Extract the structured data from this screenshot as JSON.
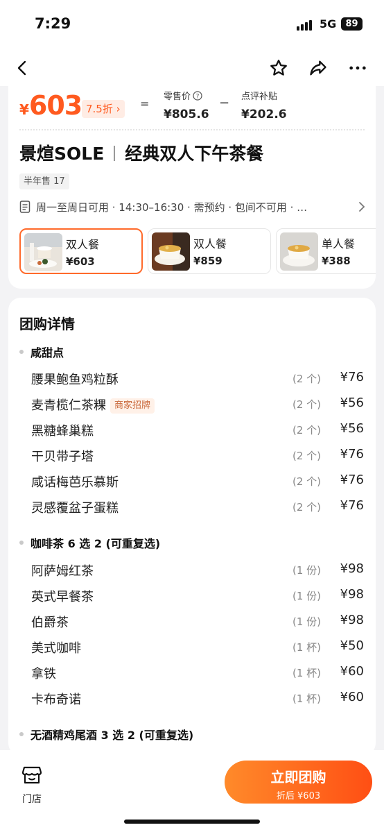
{
  "status_bar": {
    "time": "7:29",
    "network": "5G",
    "battery": "89"
  },
  "nav": {
    "icons": [
      "back-icon",
      "star-icon",
      "share-icon",
      "more-icon"
    ]
  },
  "price": {
    "symbol": "¥",
    "amount": "603",
    "discount": "7.5折",
    "equals": "=",
    "retail_label": "零售价",
    "retail_value": "¥805.6",
    "minus": "−",
    "subsidy_label": "点评补贴",
    "subsidy_value": "¥202.6"
  },
  "deal": {
    "brand": "景煊SOLE",
    "name": "经典双人下午茶餐",
    "sales": "半年售 17",
    "usage": "周一至周日可用 · 14:30–16:30 · 需预约 · 包间不可用 · …"
  },
  "packages": [
    {
      "name": "双人餐",
      "price": "¥603",
      "selected": true
    },
    {
      "name": "双人餐",
      "price": "¥859",
      "selected": false
    },
    {
      "name": "单人餐",
      "price": "¥388",
      "selected": false
    }
  ],
  "details": {
    "title": "团购详情",
    "sections": [
      {
        "name": "咸甜点",
        "items": [
          {
            "name": "腰果鲍鱼鸡粒酥",
            "badge": "",
            "qty": "(2 个)",
            "price": "¥76"
          },
          {
            "name": "麦青榄仁茶粿",
            "badge": "商家招牌",
            "qty": "(2 个)",
            "price": "¥56"
          },
          {
            "name": "黑糖蜂巢糕",
            "badge": "",
            "qty": "(2 个)",
            "price": "¥56"
          },
          {
            "name": "干贝带子塔",
            "badge": "",
            "qty": "(2 个)",
            "price": "¥76"
          },
          {
            "name": "咸话梅芭乐慕斯",
            "badge": "",
            "qty": "(2 个)",
            "price": "¥76"
          },
          {
            "name": "灵感覆盆子蛋糕",
            "badge": "",
            "qty": "(2 个)",
            "price": "¥76"
          }
        ]
      },
      {
        "name": "咖啡茶 6 选 2 (可重复选)",
        "items": [
          {
            "name": "阿萨姆红茶",
            "badge": "",
            "qty": "(1 份)",
            "price": "¥98"
          },
          {
            "name": "英式早餐茶",
            "badge": "",
            "qty": "(1 份)",
            "price": "¥98"
          },
          {
            "name": "伯爵茶",
            "badge": "",
            "qty": "(1 份)",
            "price": "¥98"
          },
          {
            "name": "美式咖啡",
            "badge": "",
            "qty": "(1 杯)",
            "price": "¥50"
          },
          {
            "name": "拿铁",
            "badge": "",
            "qty": "(1 杯)",
            "price": "¥60"
          },
          {
            "name": "卡布奇诺",
            "badge": "",
            "qty": "(1 杯)",
            "price": "¥60"
          }
        ]
      },
      {
        "name": "无酒精鸡尾酒 3 选 2 (可重复选)",
        "items": []
      }
    ]
  },
  "bottom": {
    "store_label": "门店",
    "buy_label": "立即团购",
    "buy_sub": "折后 ¥603"
  },
  "colors": {
    "accent": "#ff5a1f",
    "badge_bg": "#fff1e8",
    "background": "#f3f3f5"
  }
}
